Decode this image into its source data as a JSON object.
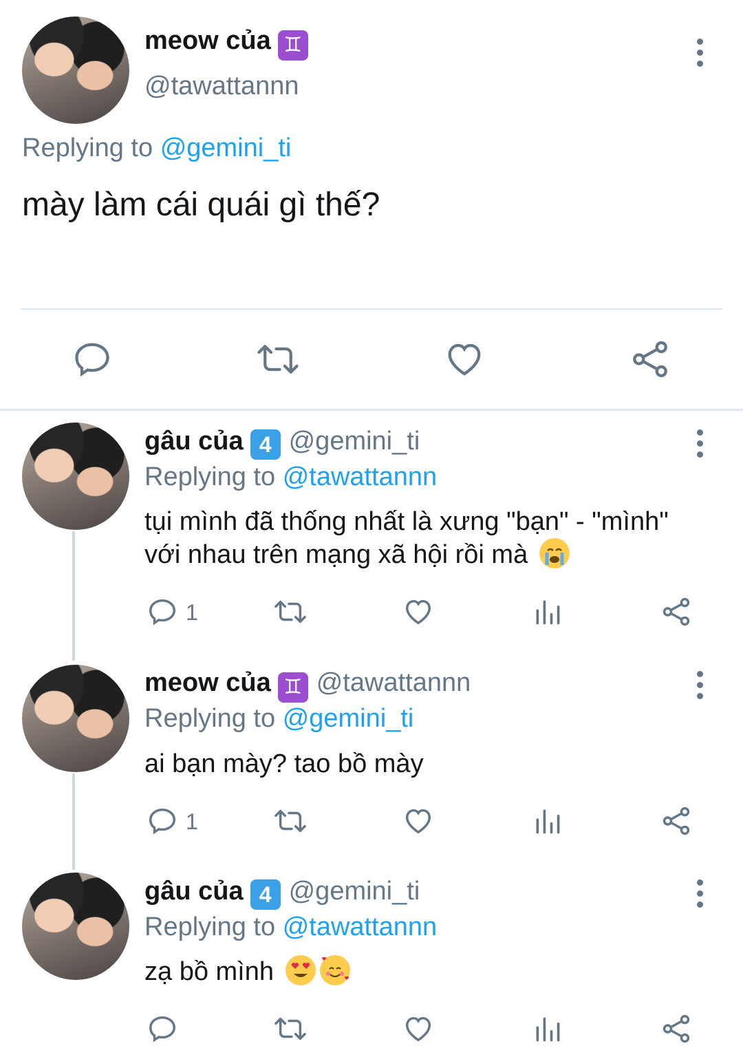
{
  "main_tweet": {
    "display_name": "meow của",
    "badge": "♊",
    "handle": "@tawattannn",
    "replying_label": "Replying to",
    "replying_to": "@gemini_ti",
    "text": "mày làm cái quái gì thế?"
  },
  "replies": [
    {
      "display_name": "gâu của",
      "badge": "4",
      "handle": "@gemini_ti",
      "replying_label": "Replying to",
      "replying_to": "@tawattannn",
      "text_line1": "tụi mình đã thống nhất là xưng \"bạn\" - \"mình\"",
      "text_line2": "với nhau trên mạng xã hội rồi mà",
      "reply_count": "1"
    },
    {
      "display_name": "meow của",
      "badge": "♊",
      "handle": "@tawattannn",
      "replying_label": "Replying to",
      "replying_to": "@gemini_ti",
      "text_line1": "ai bạn mày? tao bồ mày",
      "reply_count": "1"
    },
    {
      "display_name": "gâu của",
      "badge": "4",
      "handle": "@gemini_ti",
      "replying_label": "Replying to",
      "replying_to": "@tawattannn",
      "text_line1": "zạ bồ mình"
    }
  ],
  "colors": {
    "accent": "#1da1f2",
    "secondary_text": "#657786",
    "divider": "#e1e8ed"
  },
  "icons": [
    "reply-icon",
    "retweet-icon",
    "like-icon",
    "share-icon",
    "analytics-icon",
    "more-icon"
  ]
}
